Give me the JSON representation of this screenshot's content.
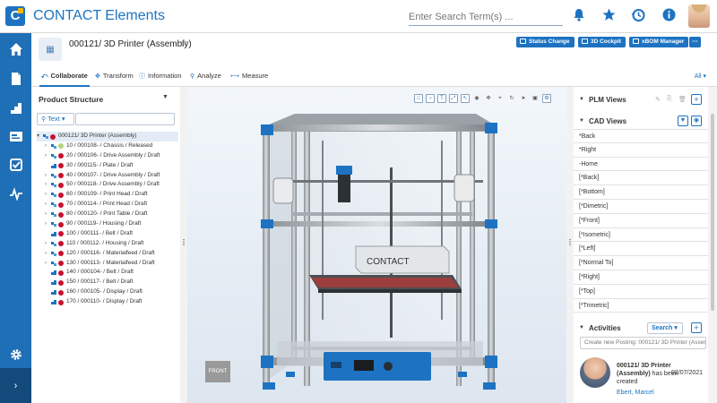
{
  "app": {
    "title": "CONTACT Elements",
    "logo_letter": "C"
  },
  "search": {
    "placeholder": "Enter Search Term(s) ..."
  },
  "topbar": {
    "icons": [
      "bell-icon",
      "star-icon",
      "history-icon",
      "info-icon"
    ]
  },
  "leftnav": {
    "items": [
      "home-icon",
      "document-icon",
      "stairs-icon",
      "card-icon",
      "checkbox-icon",
      "pulse-icon"
    ],
    "bottom": [
      "gear-icon"
    ],
    "expand": "›"
  },
  "object": {
    "title": "000121/ 3D Printer (Assembly)",
    "thumb": "▦",
    "star": "☆",
    "actions": [
      "Status Change",
      "3D Cockpit",
      "xBOM Manager"
    ],
    "more": "⋯"
  },
  "tabs": [
    {
      "label": "Collaborate",
      "icon": "⤺"
    },
    {
      "label": "Transform",
      "icon": "✥"
    },
    {
      "label": "Information",
      "icon": "ⓘ"
    },
    {
      "label": "Analyze",
      "icon": "⚲"
    },
    {
      "label": "Measure",
      "icon": "⟷"
    }
  ],
  "tabs_all": "All ▾",
  "product_structure": {
    "title": "Product Structure",
    "filter_label": "Text ▾",
    "rows": [
      {
        "text": "000121/ 3D Printer (Assembly)",
        "indent": 0,
        "status": "red",
        "twisty": "▾",
        "type": "asm",
        "highlight": true
      },
      {
        "text": "10 / 000108- / Chassis / Released",
        "indent": 1,
        "status": "green",
        "twisty": "›",
        "type": "asm"
      },
      {
        "text": "20 / 000106- / Drive Assembly / Draft",
        "indent": 1,
        "status": "red",
        "twisty": "›",
        "type": "asm"
      },
      {
        "text": "30 / 000115- / Plate / Draft",
        "indent": 1,
        "status": "red",
        "twisty": "",
        "type": "part"
      },
      {
        "text": "40 / 000107- / Drive Assembly / Draft",
        "indent": 1,
        "status": "red",
        "twisty": "›",
        "type": "asm"
      },
      {
        "text": "50 / 000118- / Drive Assembly / Draft",
        "indent": 1,
        "status": "red",
        "twisty": "›",
        "type": "asm"
      },
      {
        "text": "60 / 000109- / Print Head / Draft",
        "indent": 1,
        "status": "red",
        "twisty": "›",
        "type": "asm"
      },
      {
        "text": "70 / 000114- / Print Head / Draft",
        "indent": 1,
        "status": "red",
        "twisty": "›",
        "type": "asm"
      },
      {
        "text": "80 / 000120- / Print Table / Draft",
        "indent": 1,
        "status": "red",
        "twisty": "›",
        "type": "asm"
      },
      {
        "text": "90 / 000119- / Housing / Draft",
        "indent": 1,
        "status": "red",
        "twisty": "›",
        "type": "asm"
      },
      {
        "text": "100 / 000111- / Belt / Draft",
        "indent": 1,
        "status": "red",
        "twisty": "",
        "type": "part"
      },
      {
        "text": "110 / 000112- / Housing / Draft",
        "indent": 1,
        "status": "red",
        "twisty": "›",
        "type": "asm"
      },
      {
        "text": "120 / 000116- / Materialfeed / Draft",
        "indent": 1,
        "status": "red",
        "twisty": "›",
        "type": "asm"
      },
      {
        "text": "130 / 000113- / Materialfeed / Draft",
        "indent": 1,
        "status": "red",
        "twisty": "›",
        "type": "asm"
      },
      {
        "text": "140 / 000104- / Belt / Draft",
        "indent": 1,
        "status": "red",
        "twisty": "",
        "type": "part"
      },
      {
        "text": "150 / 000117- / Belt / Draft",
        "indent": 1,
        "status": "red",
        "twisty": "",
        "type": "part"
      },
      {
        "text": "160 / 000105- / Display / Draft",
        "indent": 1,
        "status": "red",
        "twisty": "",
        "type": "part"
      },
      {
        "text": "170 / 000110- / Display / Draft",
        "indent": 1,
        "status": "red",
        "twisty": "",
        "type": "part"
      }
    ]
  },
  "viewer": {
    "toolbar": [
      "□",
      "○",
      "T",
      "⤢",
      "↖",
      "◉",
      "✥",
      "⌖",
      "↻",
      "➤",
      "▣",
      "⚙"
    ],
    "model_label": "CONTACT",
    "viewcube": "FRONT"
  },
  "plm_views": {
    "title": "PLM Views",
    "icons": [
      "✎",
      "⎘",
      "🗑"
    ],
    "add": "+"
  },
  "cad_views": {
    "title": "CAD Views",
    "items": [
      "*Back",
      "*Right",
      "-Home",
      "[*Back]",
      "[*Bottom]",
      "[*Dimetric]",
      "[*Front]",
      "[*Isometric]",
      "[*Left]",
      "[*Normal To]",
      "[*Right]",
      "[*Top]",
      "[*Trimetric]"
    ]
  },
  "activities": {
    "title": "Activities",
    "search_label": "Search ▾",
    "add": "+",
    "posting_placeholder": "Create new Posting: 000121/ 3D Printer (Assem",
    "entry": {
      "subject": "000121/ 3D Printer (Assembly)",
      "rest": " has been created",
      "date": "02/07/2021",
      "author": "Ebert, Marcel"
    }
  },
  "colors": {
    "brand": "#1d73c2",
    "nav": "#1f6fb6",
    "status_red": "#c8102e",
    "status_green": "#b8d37a"
  }
}
